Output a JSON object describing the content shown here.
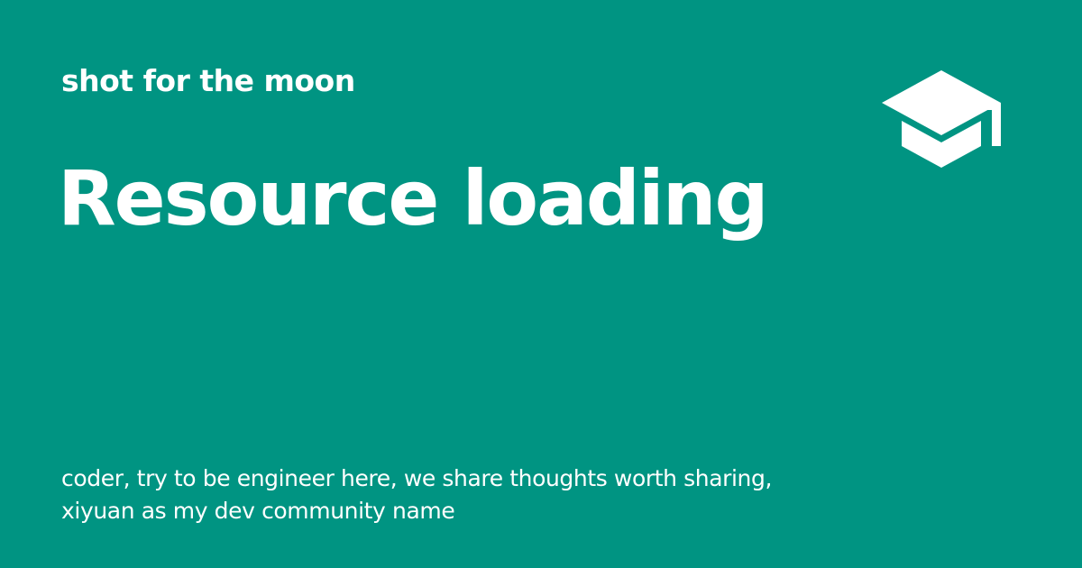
{
  "site": {
    "name": "shot for the moon"
  },
  "page": {
    "title": "Resource loading"
  },
  "description": {
    "line1": "coder, try to be engineer here, we share thoughts worth sharing,",
    "line2": "xiyuan as my dev community name"
  },
  "icon": "graduation-cap-icon",
  "colors": {
    "background": "#009482",
    "foreground": "#ffffff"
  }
}
